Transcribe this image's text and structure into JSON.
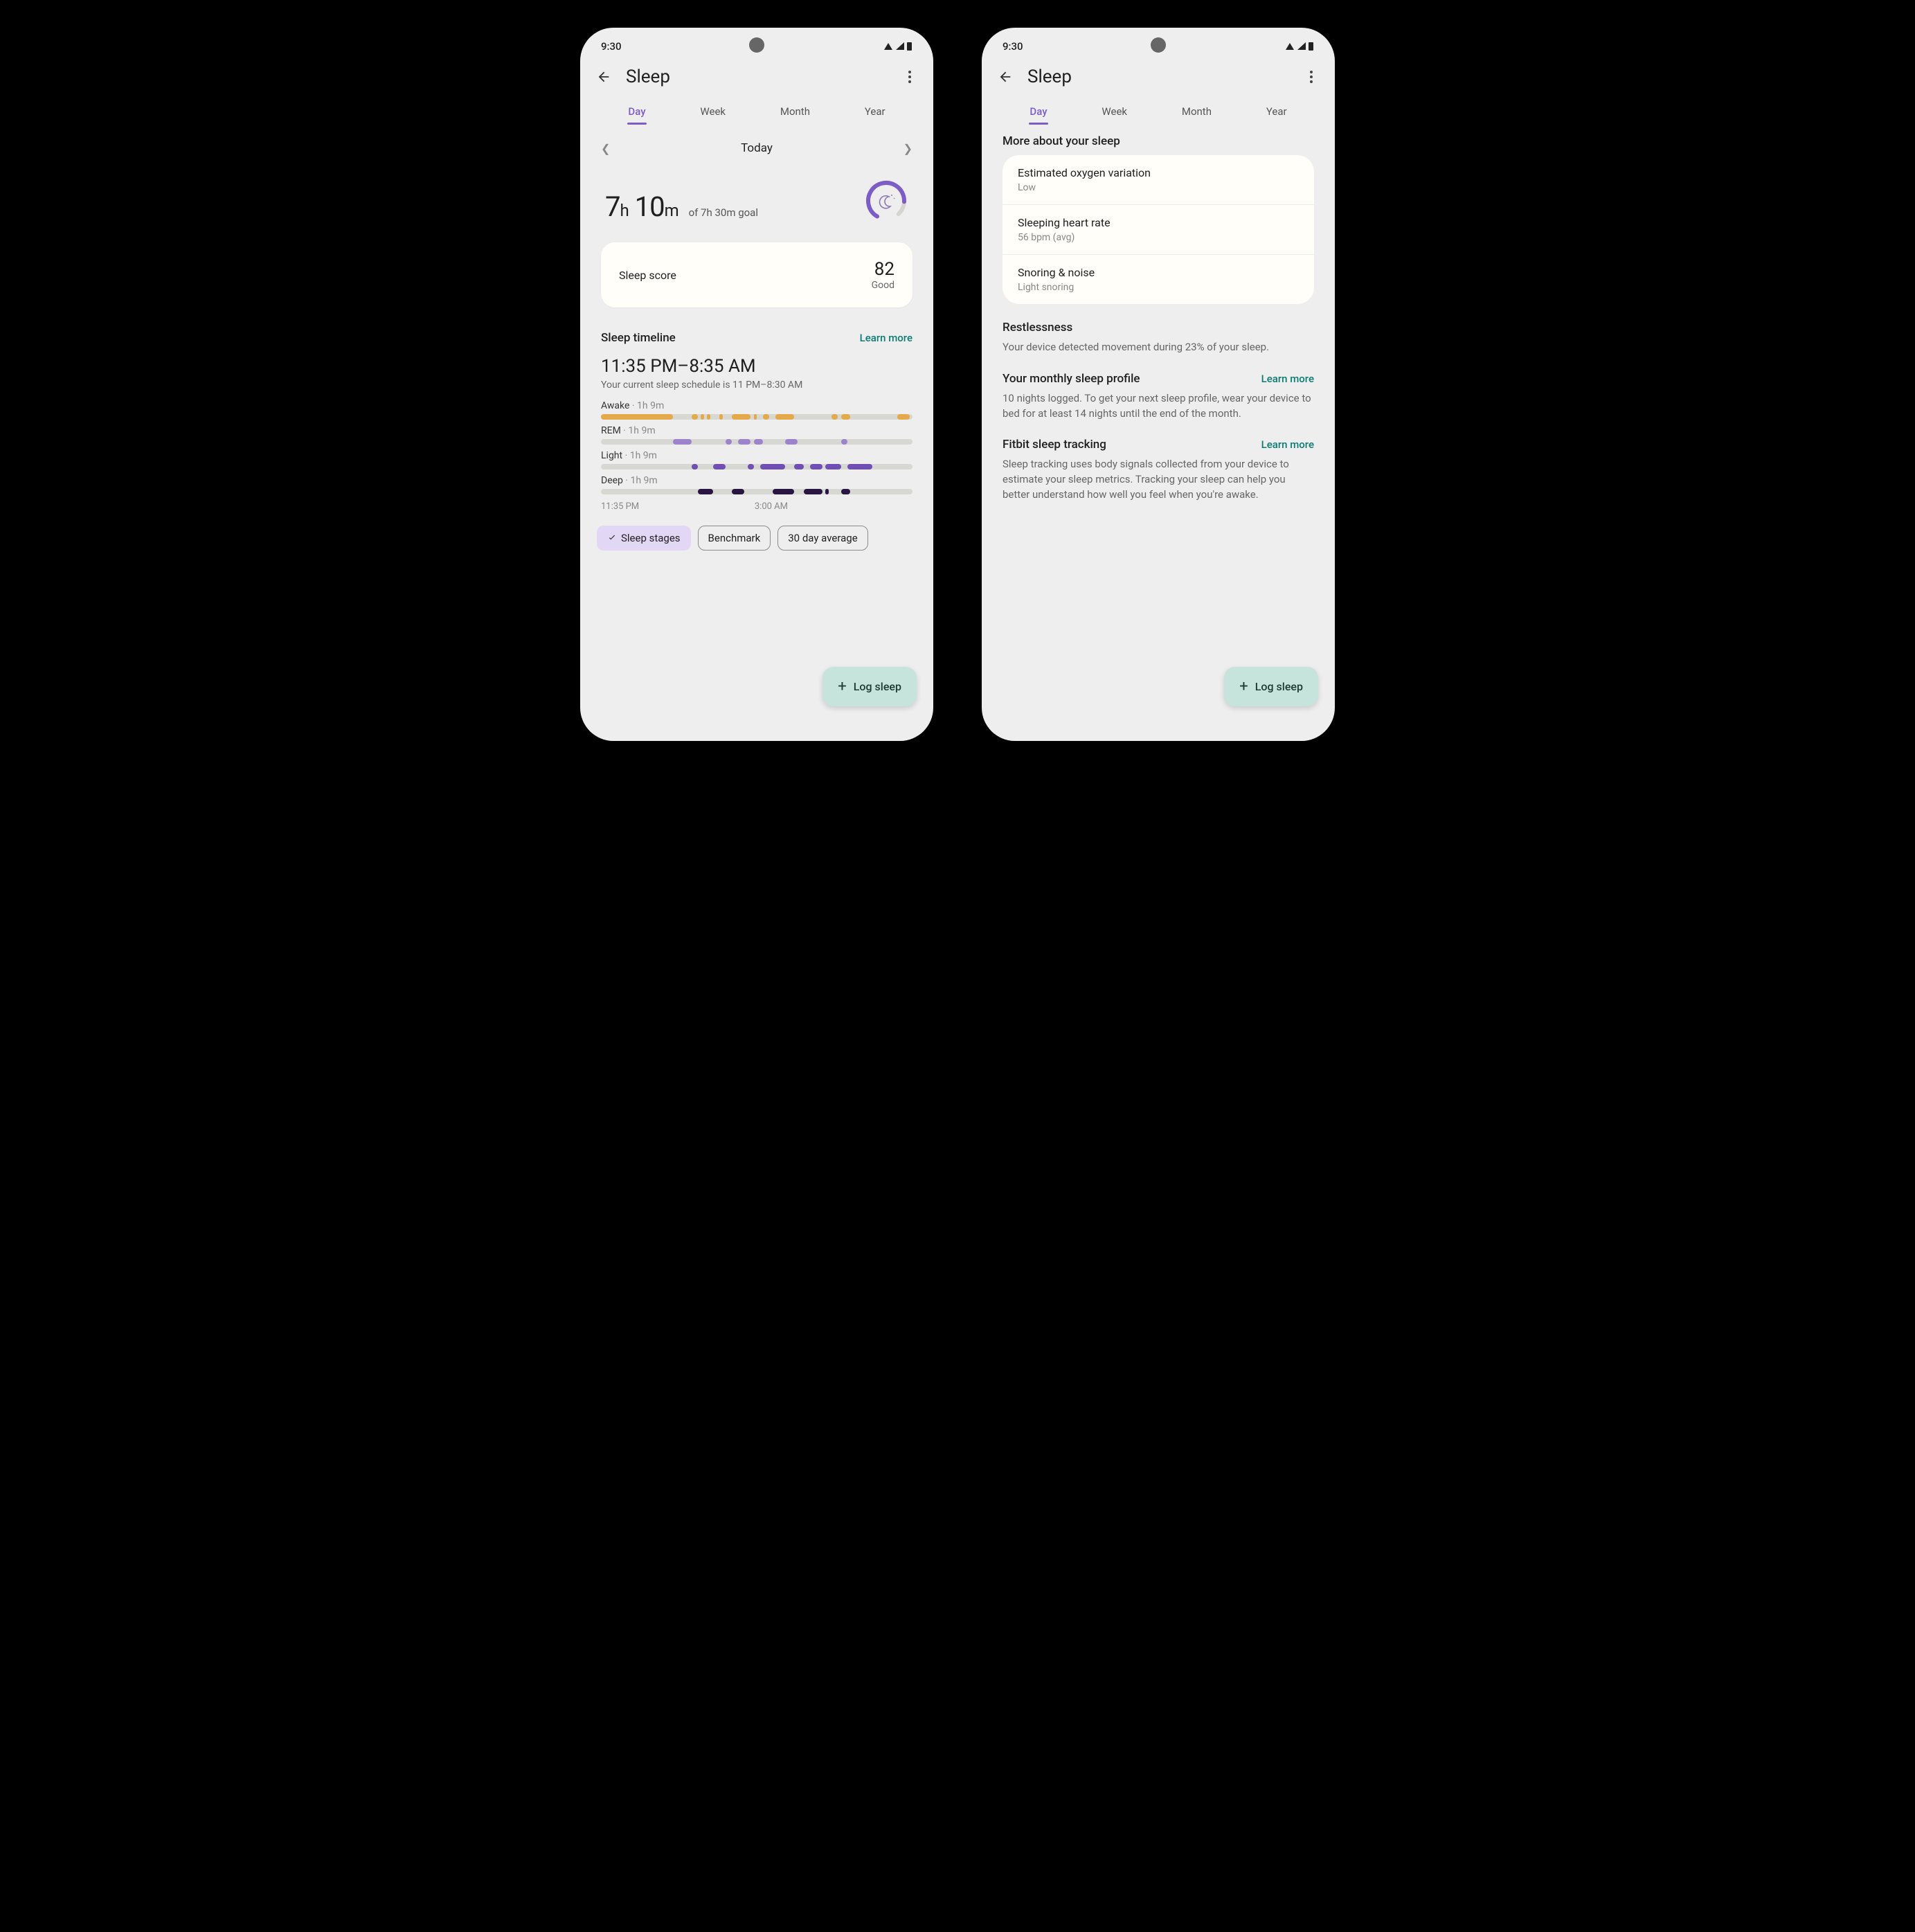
{
  "status": {
    "time": "9:30"
  },
  "app": {
    "title": "Sleep"
  },
  "tabs": [
    "Day",
    "Week",
    "Month",
    "Year"
  ],
  "daylabel": "Today",
  "summary": {
    "hours": "7",
    "hours_unit": "h",
    "mins": "10",
    "mins_unit": "m",
    "goal": "of 7h 30m goal"
  },
  "score": {
    "label": "Sleep score",
    "value": "82",
    "rating": "Good"
  },
  "timeline": {
    "title": "Sleep timeline",
    "learn": "Learn more",
    "range": "11:35 PM–8:35 AM",
    "schedule": "Your current sleep schedule is 11 PM–8:30 AM",
    "stages": [
      {
        "name": "Awake",
        "dur": "1h 9m",
        "color": "var(--awake)",
        "segs": [
          [
            0,
            23
          ],
          [
            29,
            2
          ],
          [
            32,
            1
          ],
          [
            34,
            1
          ],
          [
            38,
            1
          ],
          [
            42,
            6
          ],
          [
            49,
            1
          ],
          [
            52,
            2
          ],
          [
            56,
            6
          ],
          [
            74,
            2
          ],
          [
            77,
            3
          ],
          [
            95,
            4
          ]
        ]
      },
      {
        "name": "REM",
        "dur": "1h 9m",
        "color": "var(--rem)",
        "segs": [
          [
            23,
            6
          ],
          [
            40,
            2
          ],
          [
            44,
            4
          ],
          [
            49,
            3
          ],
          [
            59,
            4
          ],
          [
            77,
            2
          ]
        ]
      },
      {
        "name": "Light",
        "dur": "1h 9m",
        "color": "var(--light)",
        "segs": [
          [
            29,
            2
          ],
          [
            36,
            4
          ],
          [
            47,
            2
          ],
          [
            51,
            8
          ],
          [
            62,
            3
          ],
          [
            67,
            4
          ],
          [
            72,
            5
          ],
          [
            79,
            8
          ]
        ]
      },
      {
        "name": "Deep",
        "dur": "1h 9m",
        "color": "var(--deep)",
        "segs": [
          [
            31,
            5
          ],
          [
            42,
            4
          ],
          [
            55,
            7
          ],
          [
            65,
            6
          ],
          [
            72,
            1
          ],
          [
            77,
            3
          ]
        ]
      }
    ],
    "xaxis": [
      "11:35 PM",
      "3:00 AM"
    ]
  },
  "chips": [
    "Sleep stages",
    "Benchmark",
    "30 day average"
  ],
  "fab": "Log sleep",
  "more": {
    "title": "More about your sleep",
    "items": [
      {
        "t": "Estimated oxygen variation",
        "s": "Low"
      },
      {
        "t": "Sleeping heart rate",
        "s": "56 bpm (avg)"
      },
      {
        "t": "Snoring & noise",
        "s": "Light snoring"
      }
    ]
  },
  "restless": {
    "title": "Restlessness",
    "body": "Your device detected movement during 23% of your sleep."
  },
  "profile": {
    "title": "Your monthly sleep profile",
    "learn": "Learn more",
    "body": "10 nights logged. To get your next sleep profile, wear your device to bed for at least 14 nights until the end of the month."
  },
  "tracking": {
    "title": "Fitbit sleep tracking",
    "learn": "Learn more",
    "body": "Sleep tracking uses body signals collected from your device to estimate your sleep metrics. Tracking your sleep can help you better understand how well you feel when you're awake."
  }
}
